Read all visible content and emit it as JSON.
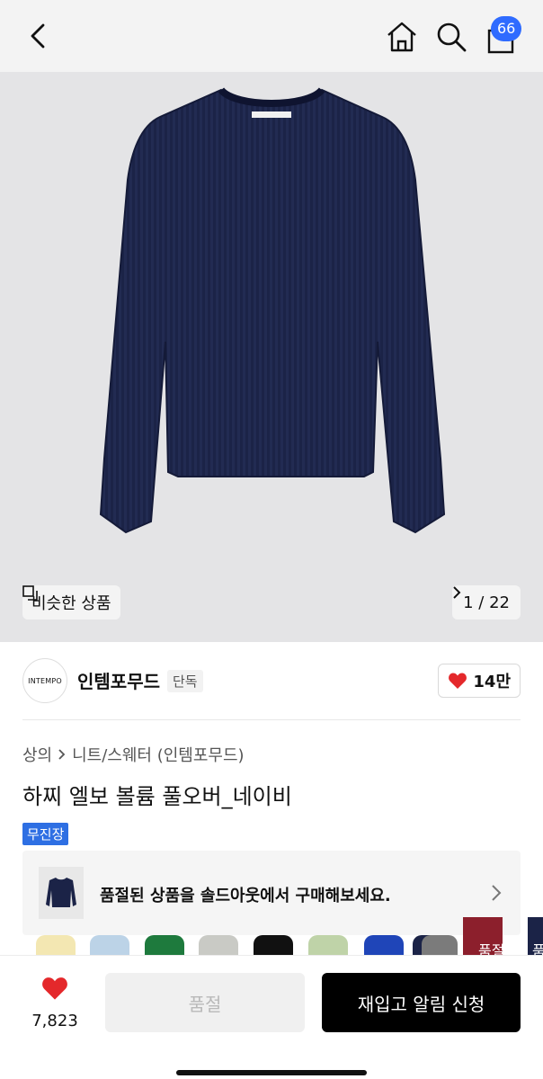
{
  "header": {
    "back_icon": "chevron-left-icon",
    "home_icon": "home-icon",
    "search_icon": "search-icon",
    "cart_icon": "shopping-bag-icon",
    "cart_count": "66"
  },
  "gallery": {
    "similar_label": "비슷한 상품",
    "pager": "1 / 22",
    "background": "#e4e4e6",
    "product_color": "#1b2347"
  },
  "brand": {
    "logo_text": "INTEMPO",
    "name": "인템포무드",
    "tag": "단독",
    "likes": "14만"
  },
  "product": {
    "breadcrumb": [
      "상의",
      "니트/스웨터 (인템포무드)"
    ],
    "title": "하찌 엘보 볼륨 풀오버_네이비",
    "badge": "무진장"
  },
  "soldout_banner": {
    "text": "품절된 상품을 솔드아웃에서 구매해보세요."
  },
  "swatches": {
    "colors": [
      "#f3e7b2",
      "#bcd3e7",
      "#1e7a3d",
      "#c9cac5",
      "#111111",
      "#bfd3a8",
      "#1f45b8",
      "#1b2347",
      "#7b7b7b",
      "#8c1f2c"
    ],
    "labels": [
      "품절",
      "품"
    ]
  },
  "bottom": {
    "wish_count": "7,823",
    "soldout_label": "품절",
    "notify_label": "재입고 알림 신청"
  },
  "colors": {
    "accent_blue": "#2f6bff",
    "heart_red": "#e4282b",
    "badge_blue": "#2e6fe3"
  }
}
